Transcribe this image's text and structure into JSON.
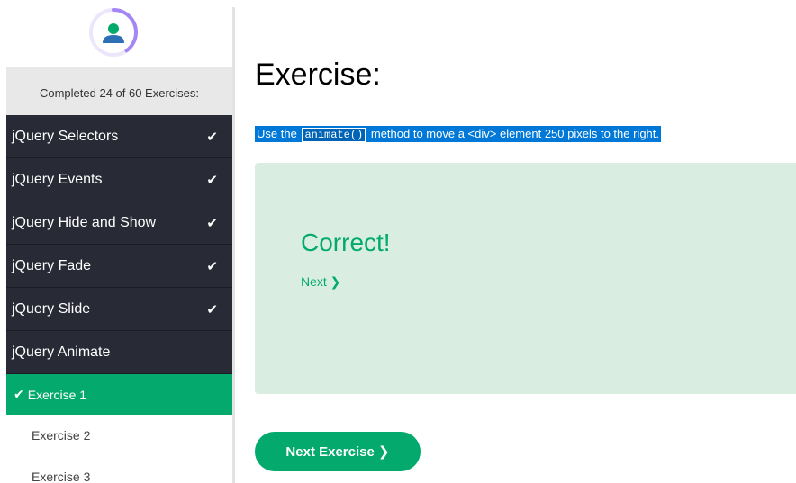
{
  "sidebar": {
    "progress_text": "Completed 24 of 60 Exercises:",
    "progress": 0.4,
    "menu": [
      {
        "label": "jQuery Selectors",
        "completed": true,
        "check": "✔"
      },
      {
        "label": "jQuery Events",
        "completed": true,
        "check": "✔"
      },
      {
        "label": "jQuery Hide and Show",
        "completed": true,
        "check": "✔"
      },
      {
        "label": "jQuery Fade",
        "completed": true,
        "check": "✔"
      },
      {
        "label": "jQuery Slide",
        "completed": true,
        "check": "✔"
      },
      {
        "label": "jQuery Animate",
        "completed": false,
        "check": ""
      }
    ],
    "sub_items": [
      {
        "label": "Exercise 1",
        "active": true,
        "check": "✔"
      },
      {
        "label": "Exercise 2",
        "active": false
      },
      {
        "label": "Exercise 3",
        "active": false
      }
    ]
  },
  "main": {
    "title": "Exercise:",
    "instruction": {
      "before": "Use the",
      "code": "animate()",
      "after": "method to move a <div> element 250 pixels to the right."
    },
    "result": {
      "status": "Correct!",
      "next_link": "Next ❯"
    },
    "next_button": "Next Exercise ❯"
  },
  "colors": {
    "accent": "#04aa6d",
    "menu_bg": "#282a35",
    "panel_bg": "#d9eee1",
    "selection": "#0078d7",
    "progress_ring": "#a586f5"
  },
  "icons": {
    "avatar": "user-avatar-icon",
    "check": "checkmark-icon"
  }
}
